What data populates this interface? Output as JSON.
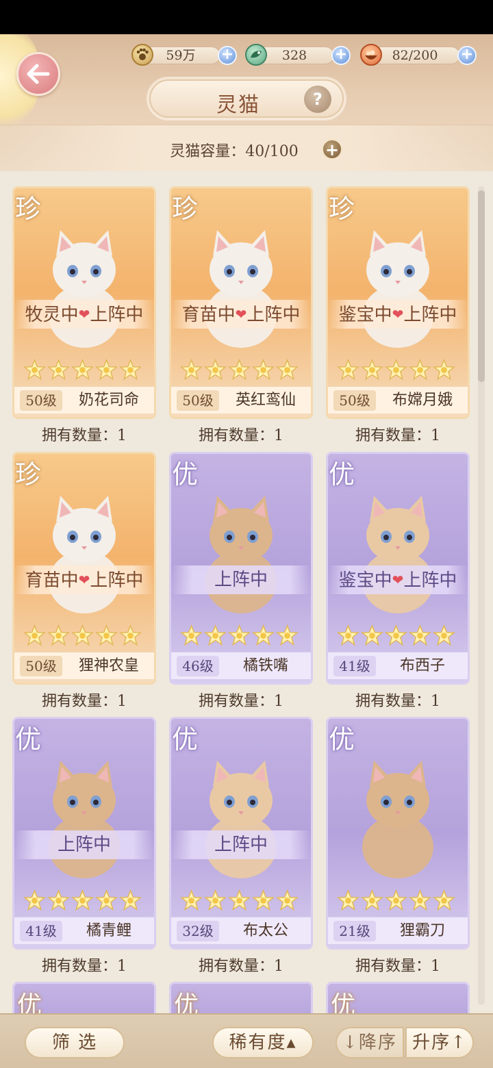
{
  "header": {
    "title": "灵猫",
    "help_label": "?",
    "resources": [
      {
        "icon": "paw-coin-icon",
        "value": "59万"
      },
      {
        "icon": "green-gem-icon",
        "value": "328"
      },
      {
        "icon": "food-bowl-icon",
        "value": "82/200"
      }
    ],
    "capacity": "灵猫容量：40/100"
  },
  "cats": [
    {
      "rarity": "珍",
      "status": [
        "牧灵中",
        "上阵中"
      ],
      "stars": 5,
      "level": "50级",
      "name": "奶花司命",
      "count": "拥有数量：1"
    },
    {
      "rarity": "珍",
      "status": [
        "育苗中",
        "上阵中"
      ],
      "stars": 5,
      "level": "50级",
      "name": "英红鸾仙",
      "count": "拥有数量：1"
    },
    {
      "rarity": "珍",
      "status": [
        "鉴宝中",
        "上阵中"
      ],
      "stars": 5,
      "level": "50级",
      "name": "布嫦月娥",
      "count": "拥有数量：1"
    },
    {
      "rarity": "珍",
      "status": [
        "育苗中",
        "上阵中"
      ],
      "stars": 5,
      "level": "50级",
      "name": "狸神农皇",
      "count": "拥有数量：1"
    },
    {
      "rarity": "优",
      "status": [
        "上阵中"
      ],
      "stars": 5,
      "level": "46级",
      "name": "橘铁嘴",
      "count": "拥有数量：1"
    },
    {
      "rarity": "优",
      "status": [
        "鉴宝中",
        "上阵中"
      ],
      "stars": 5,
      "level": "41级",
      "name": "布西子",
      "count": "拥有数量：1"
    },
    {
      "rarity": "优",
      "status": [
        "上阵中"
      ],
      "stars": 5,
      "level": "41级",
      "name": "橘青鲤",
      "count": "拥有数量：1"
    },
    {
      "rarity": "优",
      "status": [
        "上阵中"
      ],
      "stars": 5,
      "level": "32级",
      "name": "布太公",
      "count": "拥有数量：1"
    },
    {
      "rarity": "优",
      "status": [],
      "stars": 5,
      "level": "21级",
      "name": "狸霸刀",
      "count": "拥有数量：1"
    }
  ],
  "partial_rarity": [
    "优",
    "优",
    "优"
  ],
  "footer": {
    "filter_label": "筛 选",
    "sort_field": "稀有度▴",
    "desc_label": "↓降序",
    "asc_label": "升序↑"
  }
}
